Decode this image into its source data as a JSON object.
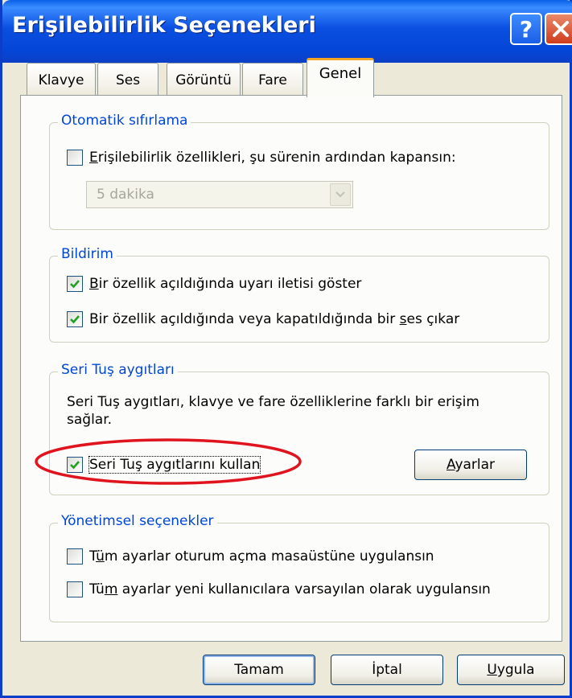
{
  "window": {
    "title": "Erişilebilirlik Seçenekleri",
    "help_label": "?",
    "close_icon": "close-icon"
  },
  "tabs": [
    {
      "label": "Klavye"
    },
    {
      "label": "Ses"
    },
    {
      "label": "Görüntü"
    },
    {
      "label": "Fare"
    },
    {
      "label": "Genel",
      "active": true
    }
  ],
  "auto_reset": {
    "legend": "Otomatik sıfırlama",
    "checkbox": {
      "label_first": "E",
      "label_rest": "rişilebilirlik özellikleri, şu sürenin ardından kapansın:",
      "checked": false
    },
    "duration": {
      "value": "5 dakika",
      "enabled": false
    }
  },
  "notification": {
    "legend": "Bildirim",
    "warning": {
      "label_first": "B",
      "label_rest": "ir özellik açıldığında uyarı iletisi göster",
      "checked": true
    },
    "sound": {
      "label_before": "Bir özellik açıldığında veya kapatıldığında bir ",
      "label_underlined": "s",
      "label_after": "es çıkar",
      "checked": true
    }
  },
  "serial_keys": {
    "legend": "Seri Tuş aygıtları",
    "description_line1": "Seri Tuş aygıtları, klavye ve fare özelliklerine farklı bir erişim",
    "description_line2": "sağlar.",
    "use_checkbox": {
      "label": "Seri Tuş aygıtlarını kullan",
      "checked": true
    },
    "settings_button": {
      "label_first": "A",
      "label_rest": "yarlar"
    }
  },
  "admin": {
    "legend": "Yönetimsel seçenekler",
    "apply_logon": {
      "label_before": "T",
      "label_underlined": "ü",
      "label_after": "m ayarlar oturum açma masaüstüne uygulansın",
      "checked": false
    },
    "apply_new_users": {
      "label_before": "Tü",
      "label_underlined": "m",
      "label_after": " ayarlar yeni kullanıcılara varsayılan olarak uygulansın",
      "checked": false
    }
  },
  "footer": {
    "ok": "Tamam",
    "cancel": "İptal",
    "apply_first": "U",
    "apply_rest": "ygula"
  },
  "colors": {
    "titlebar": "#0a4ee0",
    "group_label": "#0046d5",
    "checkmark": "#21a121",
    "annotation": "#e0141e",
    "active_tab_accent": "#f5a623"
  }
}
